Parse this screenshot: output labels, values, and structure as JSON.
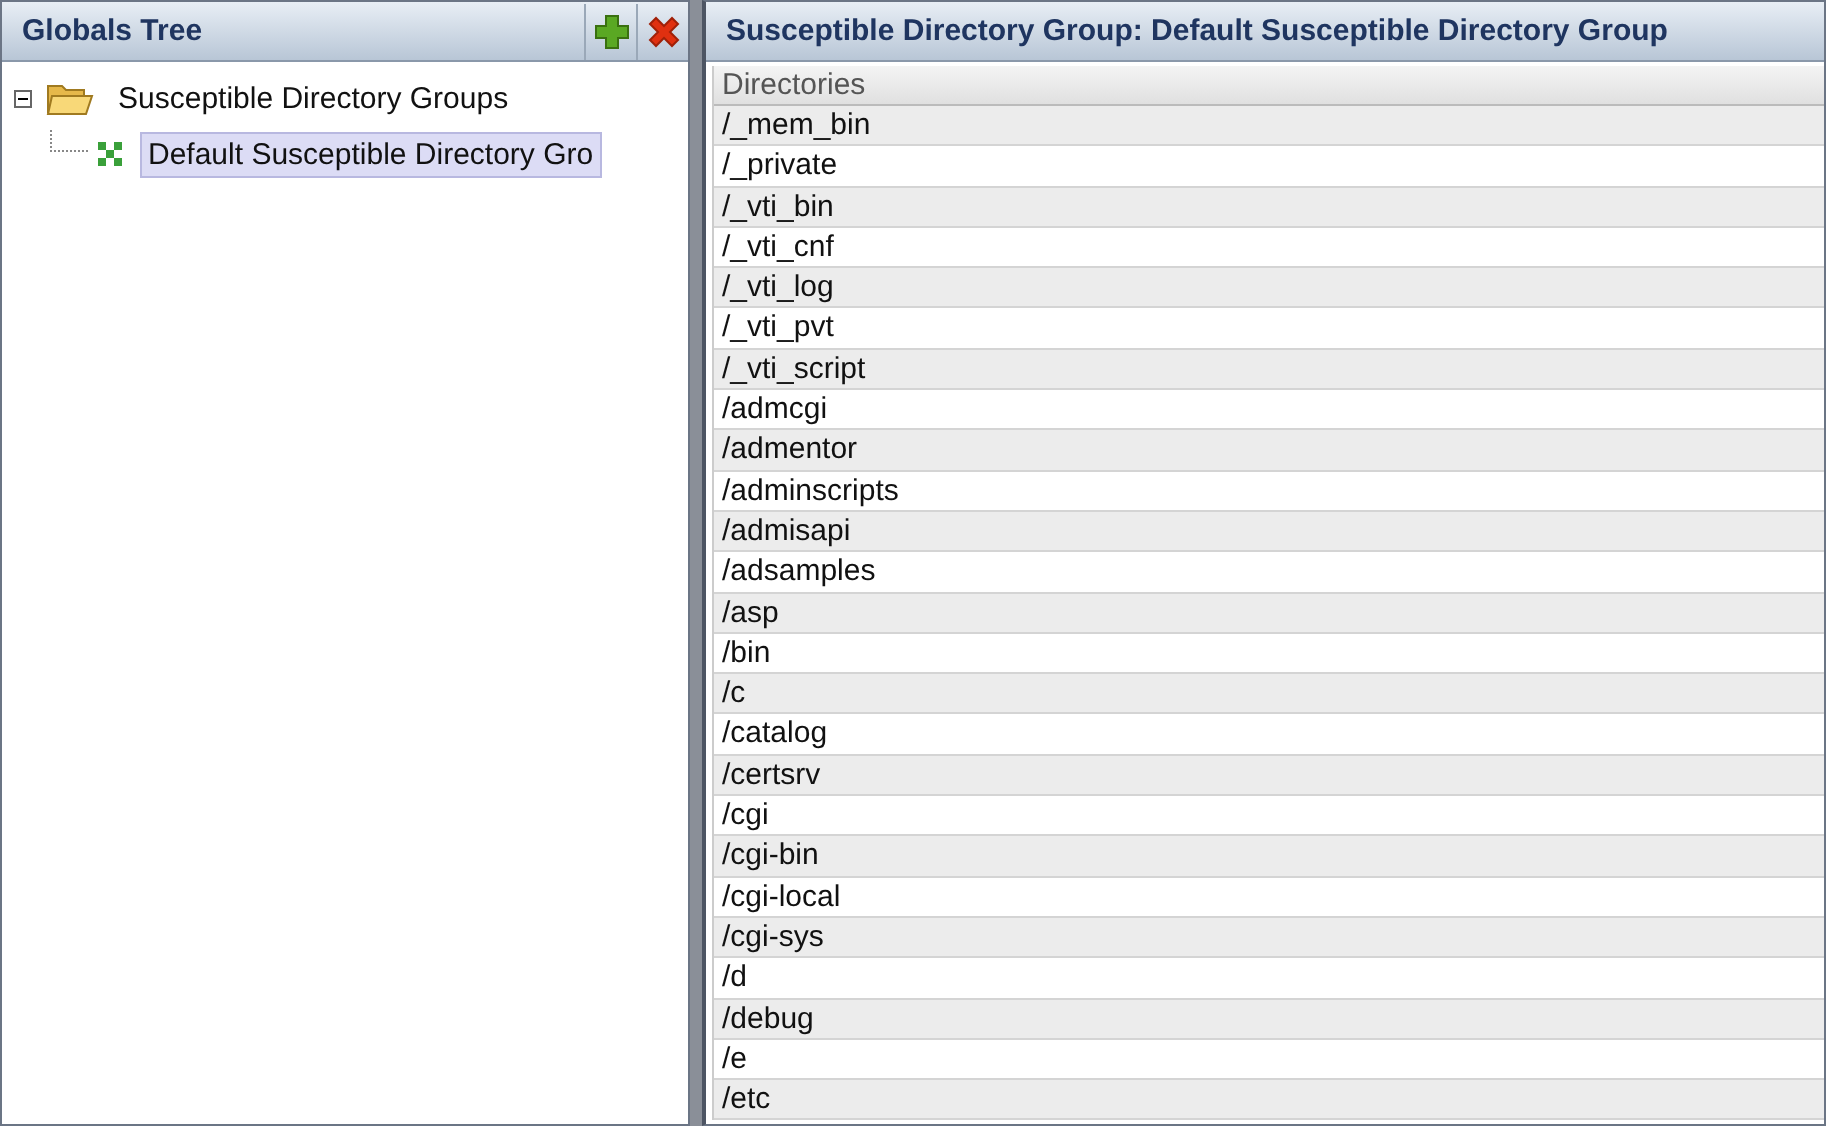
{
  "left_panel": {
    "title": "Globals Tree",
    "tree": [
      {
        "label": "Susceptible Directory Groups",
        "kind": "folder",
        "expanded": true,
        "selected": false,
        "children": [
          {
            "label": "Default Susceptible Directory Gro",
            "kind": "group",
            "selected": true
          }
        ]
      }
    ]
  },
  "right_panel": {
    "title": "Susceptible Directory Group: Default Susceptible Directory Group",
    "table": {
      "columns": [
        "Directories"
      ],
      "rows": [
        "/_mem_bin",
        "/_private",
        "/_vti_bin",
        "/_vti_cnf",
        "/_vti_log",
        "/_vti_pvt",
        "/_vti_script",
        "/admcgi",
        "/admentor",
        "/adminscripts",
        "/admisapi",
        "/adsamples",
        "/asp",
        "/bin",
        "/c",
        "/catalog",
        "/certsrv",
        "/cgi",
        "/cgi-bin",
        "/cgi-local",
        "/cgi-sys",
        "/d",
        "/debug",
        "/e",
        "/etc"
      ]
    }
  }
}
